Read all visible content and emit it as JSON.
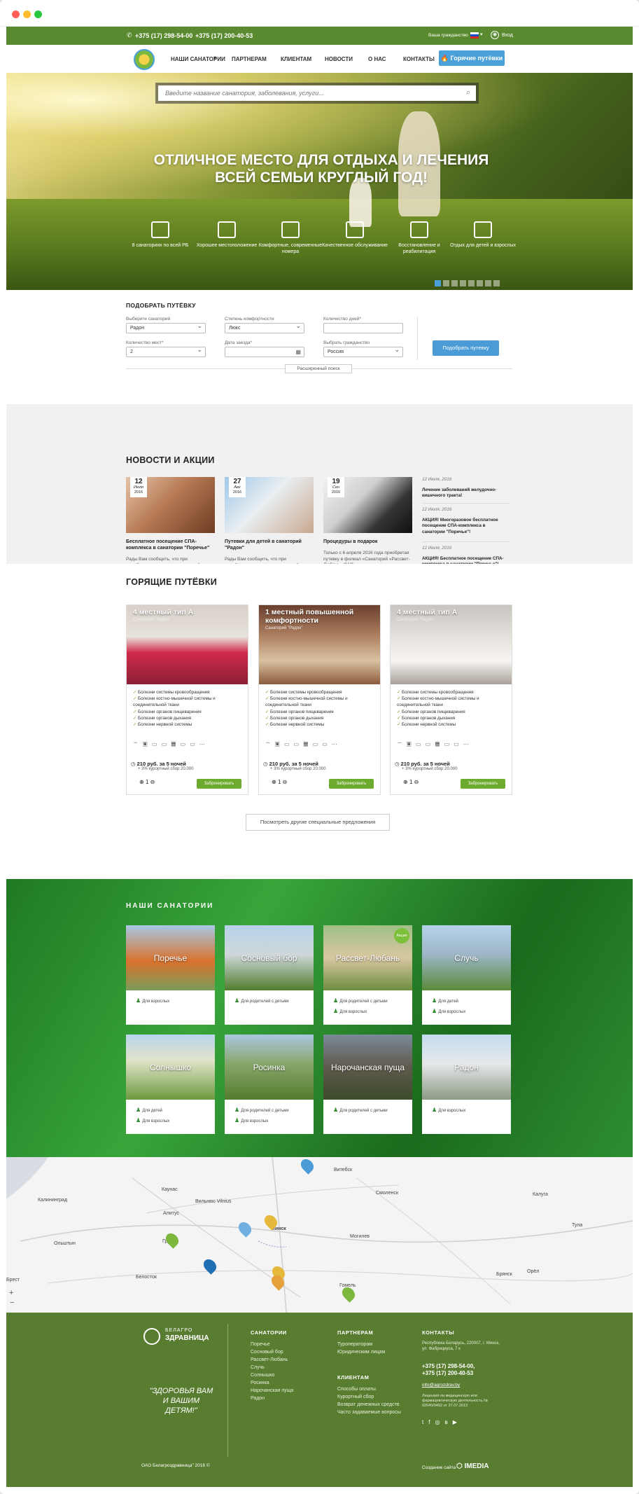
{
  "topbar": {
    "phone1": "+375 (17) 298-54-00",
    "phone2": "+375 (17) 200-40-53",
    "currency": "Ваша гражданство",
    "login": "Вход"
  },
  "nav": {
    "items": [
      "НАШИ САНАТОРИИ",
      "ПАРТНЕРАМ",
      "КЛИЕНТАМ",
      "НОВОСТИ",
      "О НАС",
      "КОНТАКТЫ"
    ],
    "hot": "Горячие путёвки"
  },
  "hero": {
    "search_placeholder": "Введите название санатория, заболевания, услуги...",
    "title_line1": "ОТЛИЧНОЕ МЕСТО ДЛЯ ОТДЫХА И ЛЕЧЕНИЯ",
    "title_line2": "ВСЕЙ СЕМЬИ КРУГЛЫЙ ГОД!",
    "features": [
      "8 санаториях по всей РБ",
      "Хорошее местоположение",
      "Комфортные, современные номера",
      "Качественное обслуживание",
      "Восстановление и реабилитация",
      "Отдых для детей и взрослых"
    ]
  },
  "finder": {
    "title": "ПОДОБРАТЬ ПУТЁВКУ",
    "l_sanatorium": "Выберите санаторий",
    "v_sanatorium": "Радон",
    "l_comfort": "Степень комфортности",
    "v_comfort": "Люкс",
    "l_days": "Количество дней*",
    "l_places": "Количество мест*",
    "v_places": "2",
    "l_date": "Дата заезда*",
    "l_country": "Выбрать гражданство",
    "v_country": "Россия",
    "submit": "Подобрать путевку",
    "extended": "Расширенный поиск"
  },
  "news": {
    "title": "НОВОСТИ И АКЦИИ",
    "cards": [
      {
        "day": "12",
        "month": "Июля",
        "year": "2016",
        "title": "Бесплатное посещение СПА-комплекса в санатории \"Поречье\"",
        "text": "Рады Вам сообщить, что при приобретении путевок в санаторий «Поречье» продолжительностью от 12..."
      },
      {
        "day": "27",
        "month": "Авг",
        "year": "2016",
        "title": "Путевки для детей в санаторий \"Радон\"",
        "text": "Рады Вам сообщить, что при приобретении путевок в санаторий «Поречье» продолжительностью от 12..."
      },
      {
        "day": "19",
        "month": "Сен",
        "year": "2016",
        "title": "Процедуры в подарок",
        "text": "Только с 6 апреля 2016 года приобретая путевку в филиал «Санаторий «Рассвет-Любань» ОАО..."
      }
    ],
    "side": [
      {
        "date": "12 Июля, 2016",
        "title": "Лечение заболеваний желудочно-кишечного тракта!"
      },
      {
        "date": "12 Июля, 2016",
        "title": "АКЦИЯ! Многоразовое бесплатное посещение СПА-комплекса в санатории \"Поречье\"!"
      },
      {
        "date": "12 Июля, 2016",
        "title": "АКЦИЯ! Бесплатное посещение СПА-комплекса в санатории \"Поречье\"!"
      }
    ]
  },
  "tours": {
    "title": "ГОРЯЩИЕ ПУТЁВКИ",
    "more": "Посмотреть другие специальные предложения",
    "cards": [
      {
        "title": "4 местный тип А",
        "sub": "Санаторий \"Радон\"",
        "price": "210 руб. за 5 ночей",
        "fee": "+ 3% курортный сбор 20.000",
        "qty": "1",
        "book": "Забронировать"
      },
      {
        "title": "1 местный повышенной комфортности",
        "sub": "Санаторий \"Радон\"",
        "price": "210 руб. за 5 ночей",
        "fee": "+ 3% курортный сбор 20.000",
        "qty": "1",
        "book": "Забронировать"
      },
      {
        "title": "4 местный тип А",
        "sub": "Санаторий \"Радон\"",
        "price": "210 руб. за 5 ночей",
        "fee": "+ 3% курортный сбор 20.000",
        "qty": "1",
        "book": "Забронировать"
      }
    ],
    "diseases": [
      "Болезни системы кровообращения",
      "Болезни костно-мышечной системы и соединительной ткани",
      "Болезни органов пищеварения",
      "Болезни органов дыхания",
      "Болезни нервной системы"
    ]
  },
  "sanat": {
    "title": "НАШИ САНАТОРИИ",
    "badge": "Акция",
    "items": [
      {
        "name": "Поречье",
        "tags": [
          "Для взрослых"
        ]
      },
      {
        "name": "Сосновый бор",
        "tags": [
          "Для родителей с детьми"
        ]
      },
      {
        "name": "Рассвет-Любань",
        "tags": [
          "Для родителей с детьми",
          "Для взрослых"
        ]
      },
      {
        "name": "Случь",
        "tags": [
          "Для детей",
          "Для взрослых"
        ]
      },
      {
        "name": "Солнышко",
        "tags": [
          "Для детей",
          "Для взрослых"
        ]
      },
      {
        "name": "Росинка",
        "tags": [
          "Для родителей с детьми",
          "Для взрослых"
        ]
      },
      {
        "name": "Нарочанская пуща",
        "tags": [
          "Для родителей с детьми"
        ]
      },
      {
        "name": "Радон",
        "tags": [
          "Для взрослых"
        ]
      }
    ]
  },
  "map": {
    "labels": [
      "Витебск",
      "Каунас",
      "Калининград",
      "Вильнюс Vilnius",
      "Алитус",
      "Смоленск",
      "Минск",
      "Могилев",
      "Гродно",
      "Белосток",
      "Ольштын",
      "Брест",
      "Гомель",
      "Калуга",
      "Тула",
      "Орёл",
      "Брянск"
    ]
  },
  "footer": {
    "brand1": "БЕЛАГРО",
    "brand2": "ЗДРАВНИЦА",
    "slogan": "\"ЗДОРОВЬЯ ВАМ И ВАШИМ ДЕТЯМ!\"",
    "copy": "ОАО Белагроздравница\" 2016 ©",
    "h_sanat": "САНАТОРИИ",
    "sanat": [
      "Поречье",
      "Сосновый бор",
      "Рассвет-Любань",
      "Случь",
      "Солнышко",
      "Росинка",
      "Нарочанская пуща",
      "Радон"
    ],
    "h_partners": "ПАРТНЕРАМ",
    "partners": [
      "Туроператорам",
      "Юридическим лицам"
    ],
    "h_clients": "КЛИЕНТАМ",
    "clients": [
      "Способы оплаты",
      "Курортный сбор",
      "Возврат денежных средств",
      "Часто задаваемые вопросы"
    ],
    "h_contacts": "КОНТАКТЫ",
    "address": "Республика Беларусь, 220007, г. Минск, ул. Фабрициуса, 7 к",
    "ph1": "+375 (17) 298-54-00,",
    "ph2": "+375 (17) 200-40-53",
    "email": "info@agrozdrav.by",
    "license": "Лицензия на медицинскую или фармацевтическую деятельность № 02040/0452 от 27.07.2013",
    "made": "Создание сайта",
    "made_by": "IMEDIA"
  }
}
